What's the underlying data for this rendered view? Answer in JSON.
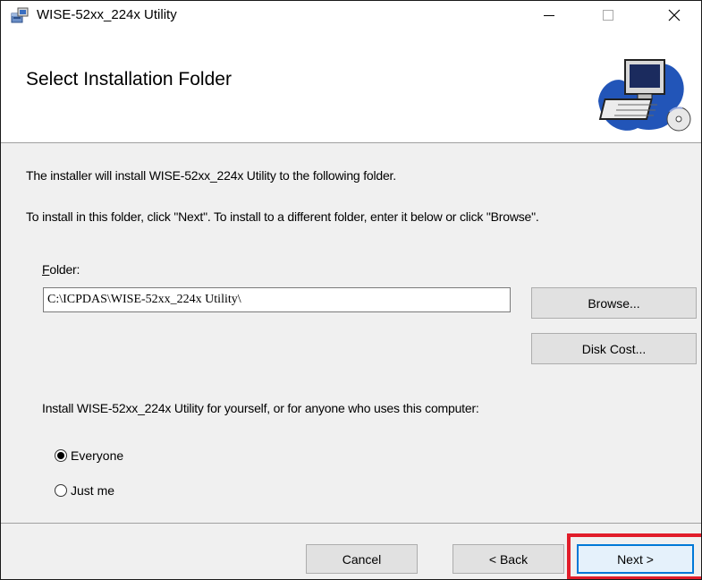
{
  "window": {
    "title": "WISE-52xx_224x Utility",
    "icon": "installer-package-icon",
    "controls": {
      "minimize": "minimize-icon",
      "maximize": "maximize-icon",
      "close": "close-icon"
    }
  },
  "banner": {
    "title": "Select Installation Folder",
    "art": "computer-install-icon"
  },
  "content": {
    "line1": "The installer will install WISE-52xx_224x Utility to the following folder.",
    "line2": "To install in this folder, click \"Next\". To install to a different folder, enter it below or click \"Browse\".",
    "folder_label_access_key": "F",
    "folder_label_rest": "older:",
    "folder_value": "C:\\ICPDAS\\WISE-52xx_224x Utility\\",
    "browse_label": "Browse...",
    "disk_cost_label": "Disk Cost...",
    "install_for": "Install WISE-52xx_224x Utility for yourself, or for anyone who uses this computer:",
    "options": [
      {
        "label": "Everyone",
        "checked": true
      },
      {
        "label": "Just me",
        "checked": false
      }
    ]
  },
  "footer": {
    "cancel_label": "Cancel",
    "back_label": "< Back",
    "next_label": "Next >"
  },
  "colors": {
    "highlight": "#e11d2a",
    "focus": "#0078d7",
    "dialog_bg": "#f0f0f0"
  }
}
